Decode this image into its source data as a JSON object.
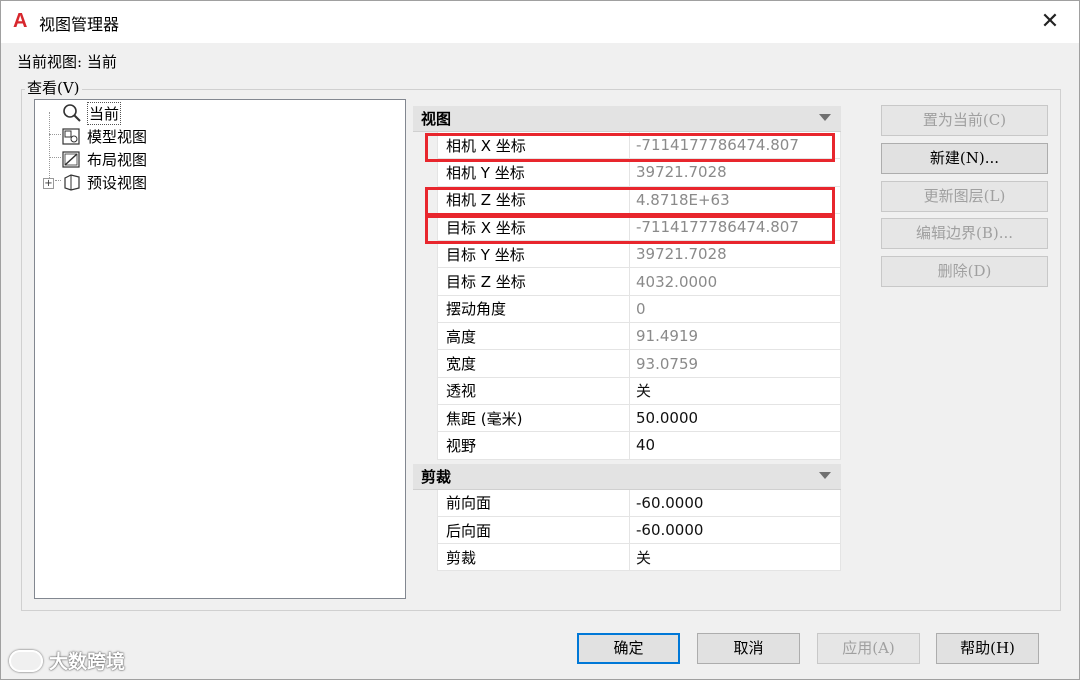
{
  "window": {
    "title": "视图管理器",
    "app_icon": "A",
    "close_glyph": "✕"
  },
  "current_view": "当前视图: 当前",
  "view_group_label": "查看(V)",
  "tree": [
    {
      "label": "当前",
      "icon": "magnifier-icon"
    },
    {
      "label": "模型视图",
      "icon": "model-view-icon"
    },
    {
      "label": "布局视图",
      "icon": "layout-view-icon"
    },
    {
      "label": "预设视图",
      "icon": "preset-view-icon",
      "expander": "+"
    }
  ],
  "properties": {
    "view_category": "视图",
    "view_rows": [
      {
        "name": "相机 X 坐标",
        "value": "-7114177786474.807",
        "editable": false
      },
      {
        "name": "相机 Y 坐标",
        "value": "39721.7028",
        "editable": false
      },
      {
        "name": "相机 Z 坐标",
        "value": "4.8718E+63",
        "editable": false
      },
      {
        "name": "目标 X 坐标",
        "value": "-7114177786474.807",
        "editable": false
      },
      {
        "name": "目标 Y 坐标",
        "value": "39721.7028",
        "editable": false
      },
      {
        "name": "目标 Z 坐标",
        "value": "4032.0000",
        "editable": false
      },
      {
        "name": "摆动角度",
        "value": "0",
        "editable": false
      },
      {
        "name": "高度",
        "value": "91.4919",
        "editable": false
      },
      {
        "name": "宽度",
        "value": "93.0759",
        "editable": false
      },
      {
        "name": "透视",
        "value": "关",
        "editable": true
      },
      {
        "name": "焦距 (毫米)",
        "value": "50.0000",
        "editable": true
      },
      {
        "name": "视野",
        "value": "40",
        "editable": true
      }
    ],
    "clip_category": "剪裁",
    "clip_rows": [
      {
        "name": "前向面",
        "value": "-60.0000",
        "editable": true
      },
      {
        "name": "后向面",
        "value": "-60.0000",
        "editable": true
      },
      {
        "name": "剪裁",
        "value": "关",
        "editable": true
      }
    ]
  },
  "side_buttons": {
    "set_current": "置为当前(C)",
    "new": "新建(N)...",
    "update_layers": "更新图层(L)",
    "edit_boundaries": "编辑边界(B)...",
    "delete": "删除(D)"
  },
  "bottom_buttons": {
    "ok": "确定",
    "cancel": "取消",
    "apply": "应用(A)",
    "help": "帮助(H)"
  },
  "watermark": "大数跨境",
  "colors": {
    "highlight": "#e8262d",
    "default_button_border": "#0078d7",
    "app_icon": "#d7272d"
  }
}
